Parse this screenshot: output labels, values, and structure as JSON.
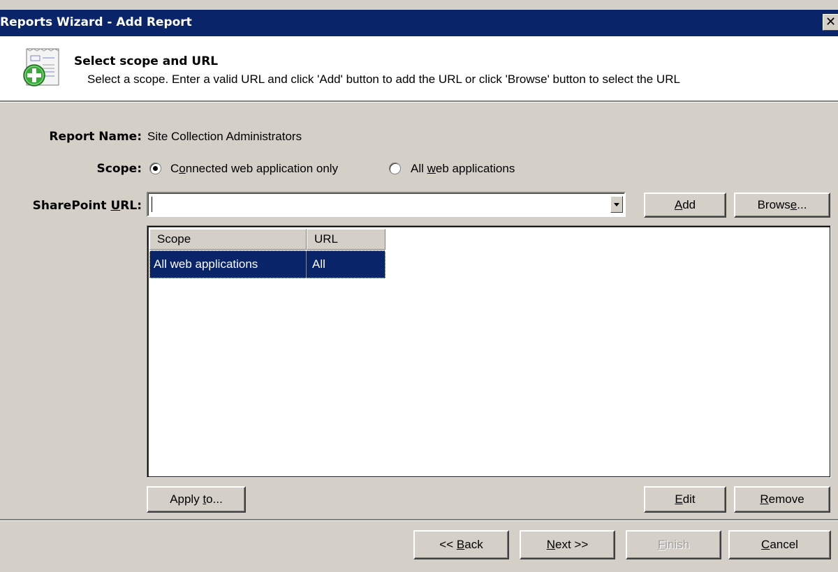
{
  "window": {
    "title": "Reports Wizard - Add Report",
    "close_glyph": "✕"
  },
  "header": {
    "title": "Select scope and URL",
    "description": "Select a scope. Enter a valid URL and click 'Add' button to add the URL or click 'Browse' button to select the URL",
    "icon": "report-add-icon"
  },
  "form": {
    "report_name_label": "Report Name:",
    "report_name_value": "Site Collection Administrators",
    "scope_label": "Scope:",
    "scope_options": [
      {
        "label_pre": "C",
        "label_ul": "o",
        "label_post": "nnected web application only",
        "checked": true
      },
      {
        "label_pre": "All ",
        "label_ul": "w",
        "label_post": "eb applications",
        "checked": false
      }
    ],
    "url_label_pre": "SharePoint ",
    "url_label_ul": "U",
    "url_label_post": "RL:",
    "url_value": "",
    "add_ul": "A",
    "add_post": "dd",
    "browse_pre": "Brows",
    "browse_ul": "e",
    "browse_post": "..."
  },
  "table": {
    "columns": [
      "Scope",
      "URL"
    ],
    "rows": [
      {
        "scope": "All web applications",
        "url": "All",
        "selected": true
      }
    ]
  },
  "list_buttons": {
    "apply_pre": "Apply ",
    "apply_ul": "t",
    "apply_post": "o...",
    "edit_ul": "E",
    "edit_post": "dit",
    "remove_ul": "R",
    "remove_post": "emove"
  },
  "footer": {
    "back_pre": "<< ",
    "back_ul": "B",
    "back_post": "ack",
    "next_ul": "N",
    "next_post": "ext >>",
    "finish_ul": "F",
    "finish_post": "inish",
    "finish_enabled": false,
    "cancel_ul": "C",
    "cancel_post": "ancel"
  },
  "colors": {
    "titlebar": "#0a246a",
    "dialog_bg": "#d4d0c8",
    "selection": "#0a246a",
    "icon_green": "#3aa83a"
  }
}
